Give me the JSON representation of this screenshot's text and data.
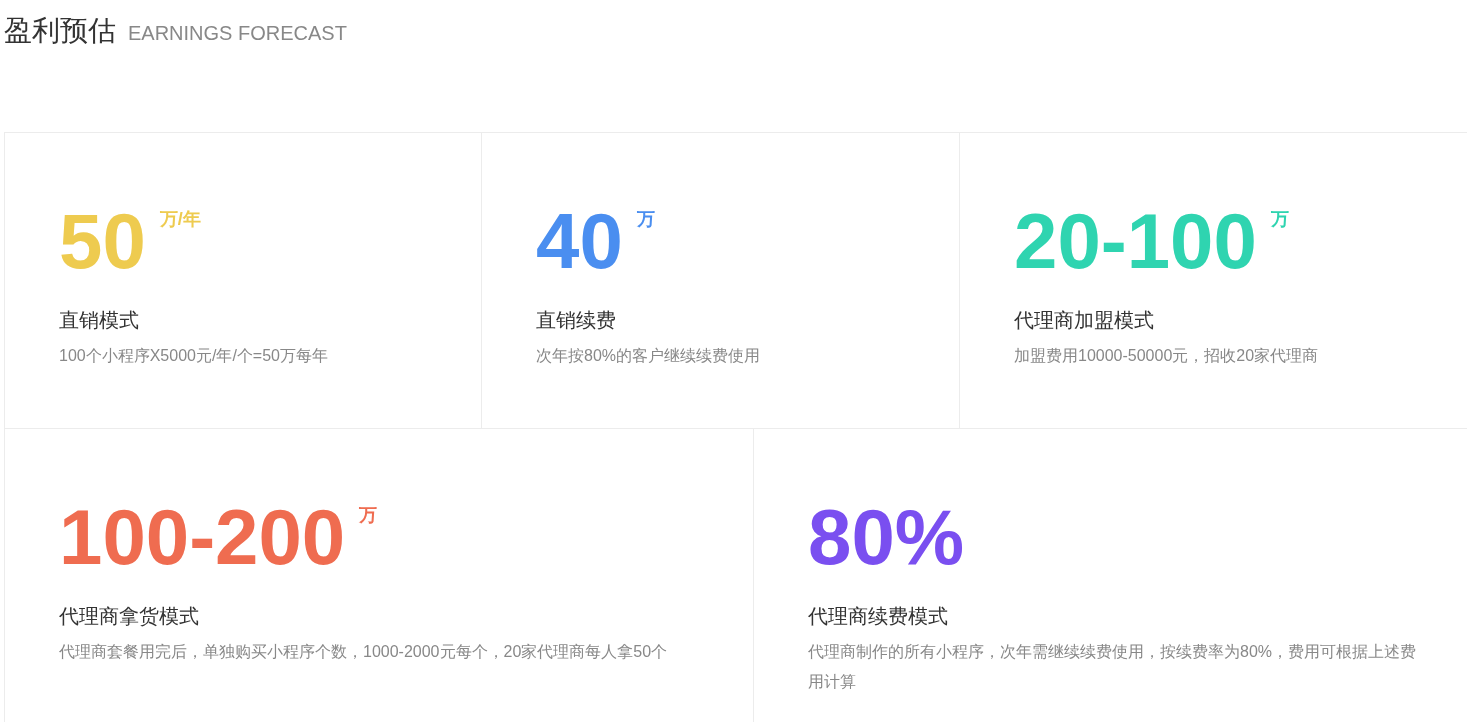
{
  "header": {
    "title": "盈利预估",
    "subtitle": "EARNINGS FORECAST"
  },
  "rows": [
    [
      {
        "value": "50",
        "unit": "万/年",
        "color": "#eecb4f",
        "title": "直销模式",
        "description": "100个小程序X5000元/年/个=50万每年"
      },
      {
        "value": "40",
        "unit": "万",
        "color": "#4a8ef0",
        "title": "直销续费",
        "description": "次年按80%的客户继续续费使用"
      },
      {
        "value": "20-100",
        "unit": "万",
        "color": "#2fd4b0",
        "title": "代理商加盟模式",
        "description": "加盟费用10000-50000元，招收20家代理商"
      }
    ],
    [
      {
        "value": "100-200",
        "unit": "万",
        "color": "#ef6c50",
        "title": "代理商拿货模式",
        "description": "代理商套餐用完后，单独购买小程序个数，1000-2000元每个，20家代理商每人拿50个"
      },
      {
        "value": "80%",
        "color": "#7a4ff0",
        "title": "代理商续费模式",
        "description": "代理商制作的所有小程序，次年需继续续费使用，按续费率为80%，费用可根据上述费用计算"
      }
    ]
  ]
}
